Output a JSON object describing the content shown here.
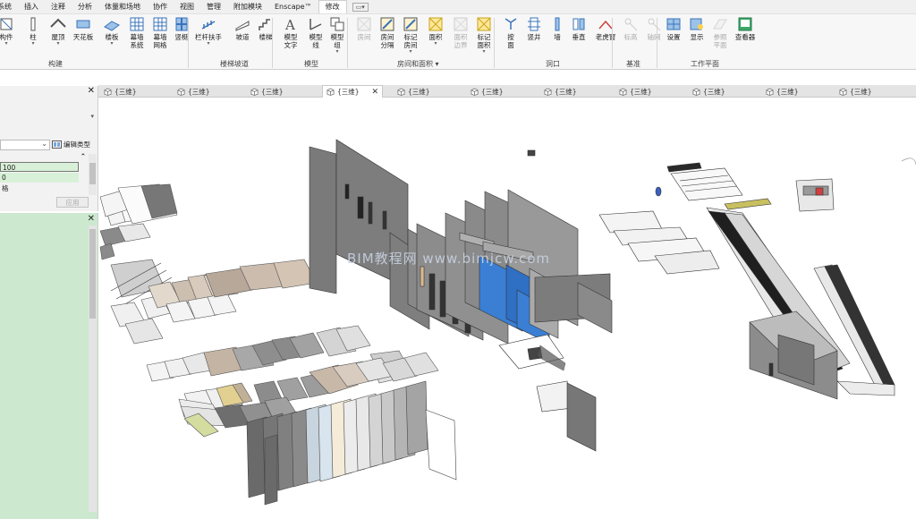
{
  "menu": {
    "items": [
      "系统",
      "插入",
      "注释",
      "分析",
      "体量和场地",
      "协作",
      "视图",
      "管理",
      "附加模块",
      "Enscape™",
      "修改"
    ],
    "extra_icon": "▭▾"
  },
  "ribbon": {
    "buttons": [
      {
        "label": "构件",
        "icon": "component-icon",
        "dd": true
      },
      {
        "label": "柱",
        "icon": "column-icon",
        "dd": true
      },
      {
        "label": "屋顶",
        "icon": "roof-icon",
        "dd": true
      },
      {
        "label": "天花板",
        "icon": "ceiling-icon",
        "dd": false
      },
      {
        "label": "楼板",
        "icon": "floor-icon",
        "dd": true
      },
      {
        "label": "幕墙\n系统",
        "icon": "curtain-system-icon",
        "dd": false
      },
      {
        "label": "幕墙\n网格",
        "icon": "curtain-grid-icon",
        "dd": false
      },
      {
        "label": "竖梃",
        "icon": "mullion-icon",
        "dd": false
      },
      {
        "label": "栏杆扶手",
        "icon": "railing-icon",
        "dd": true
      },
      {
        "label": "坡道",
        "icon": "ramp-icon",
        "dd": false
      },
      {
        "label": "楼梯",
        "icon": "stair-icon",
        "dd": false
      },
      {
        "label": "模型\n文字",
        "icon": "model-text-icon",
        "dd": false
      },
      {
        "label": "模型\n线",
        "icon": "model-line-icon",
        "dd": false
      },
      {
        "label": "模型\n组",
        "icon": "model-group-icon",
        "dd": true
      },
      {
        "label": "房间",
        "icon": "room-icon",
        "dd": false,
        "disabled": true
      },
      {
        "label": "房间\n分隔",
        "icon": "room-separator-icon",
        "dd": false
      },
      {
        "label": "标记\n房间",
        "icon": "tag-room-icon",
        "dd": true
      },
      {
        "label": "面积",
        "icon": "area-icon",
        "dd": true
      },
      {
        "label": "面积\n边界",
        "icon": "area-boundary-icon",
        "dd": false,
        "disabled": true
      },
      {
        "label": "标记\n面积",
        "icon": "tag-area-icon",
        "dd": true
      },
      {
        "label": "按\n面",
        "icon": "by-face-icon",
        "dd": false
      },
      {
        "label": "竖井",
        "icon": "shaft-icon",
        "dd": false
      },
      {
        "label": "墙",
        "icon": "wall-opening-icon",
        "dd": false
      },
      {
        "label": "垂直",
        "icon": "vertical-opening-icon",
        "dd": false
      },
      {
        "label": "老虎窗",
        "icon": "dormer-icon",
        "dd": false
      },
      {
        "label": "标高",
        "icon": "level-icon",
        "dd": false,
        "disabled": true
      },
      {
        "label": "轴网",
        "icon": "grid-icon",
        "dd": false,
        "disabled": true
      },
      {
        "label": "设置",
        "icon": "set-workplane-icon",
        "dd": false
      },
      {
        "label": "显示",
        "icon": "show-workplane-icon",
        "dd": false
      },
      {
        "label": "参照\n平面",
        "icon": "ref-plane-icon",
        "dd": false,
        "disabled": true
      },
      {
        "label": "查看器",
        "icon": "viewer-icon",
        "dd": false
      }
    ],
    "groups": [
      "构建",
      "楼梯坡道",
      "模型",
      "房间和面积 ▾",
      "洞口",
      "基准",
      "工作平面"
    ]
  },
  "tabs": {
    "label": "{三维}",
    "count": 11,
    "active_index": 3,
    "close_glyph": "✕"
  },
  "properties": {
    "close": "✕",
    "edit_type_label": "编辑类型",
    "rows": [
      {
        "text": "",
        "collapse": "⌃"
      },
      {
        "text": "100",
        "highlight": true
      },
      {
        "text": "0"
      },
      {
        "text": "格"
      }
    ],
    "apply_label": "应用"
  },
  "browser": {
    "close": "✕"
  },
  "viewport": {
    "watermark": "BIM教程网 www.bimjcw.com"
  },
  "colors": {
    "ribbon_bg": "#f7f7f7",
    "browser_bg": "#cce8cf",
    "highlight_row": "#d8f0d8",
    "wall_dark": "#6f6f6f",
    "blue_glass": "#3a7fd4",
    "tan": "#d4c0a0"
  }
}
